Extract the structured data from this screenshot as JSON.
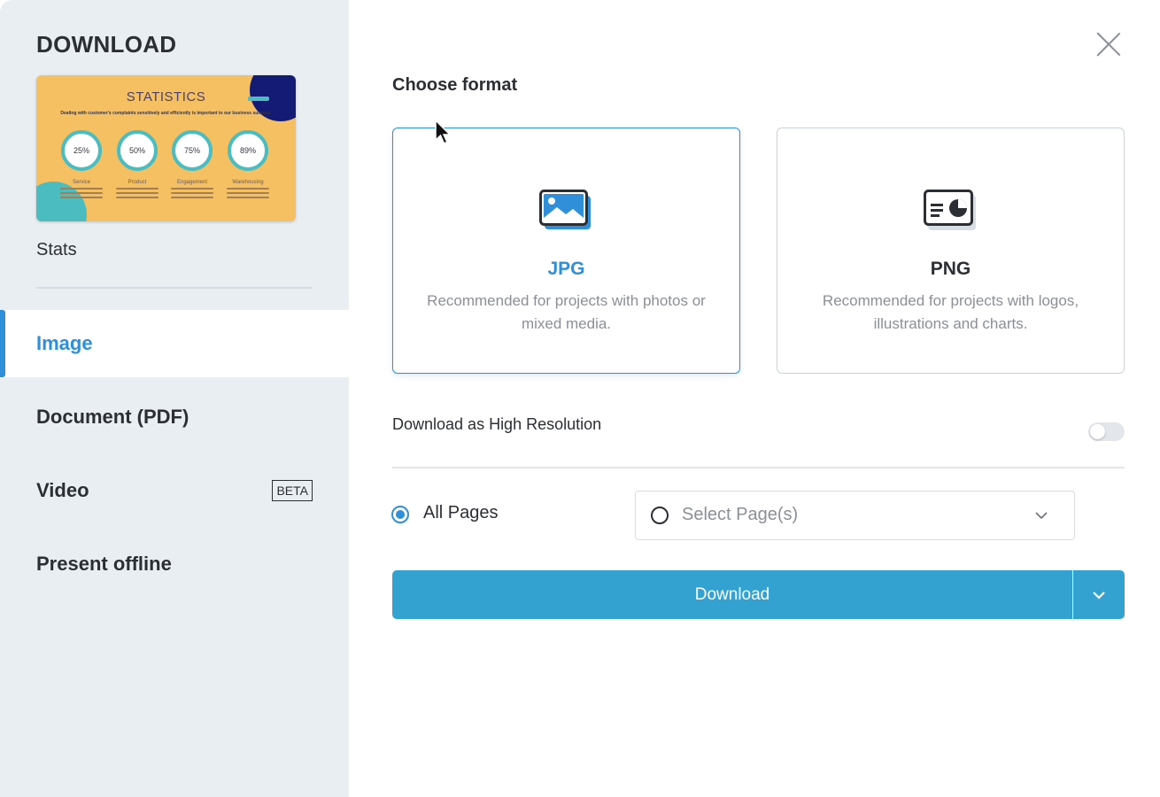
{
  "sidebar": {
    "title": "DOWNLOAD",
    "preview": {
      "title": "STATISTICS",
      "subtitle": "Dealing with customer's complaints sensitively and efficiently is important to our business success.",
      "stats": [
        {
          "value": "25%",
          "label": "Service"
        },
        {
          "value": "50%",
          "label": "Product"
        },
        {
          "value": "75%",
          "label": "Engagement"
        },
        {
          "value": "89%",
          "label": "Warehousing"
        }
      ]
    },
    "project_name": "Stats",
    "nav": [
      {
        "label": "Image",
        "active": true
      },
      {
        "label": "Document (PDF)",
        "active": false
      },
      {
        "label": "Video",
        "badge": "BETA",
        "active": false
      },
      {
        "label": "Present offline",
        "active": false
      }
    ]
  },
  "main": {
    "heading": "Choose format",
    "formats": [
      {
        "name": "JPG",
        "description": "Recommended for projects with photos or mixed media.",
        "icon": "image-icon",
        "selected": true
      },
      {
        "name": "PNG",
        "description": "Recommended for projects with logos, illustrations and charts.",
        "icon": "chart-card-icon",
        "selected": false
      }
    ],
    "high_res_label": "Download as High Resolution",
    "high_res_enabled": false,
    "pages": {
      "all_label": "All Pages",
      "select_placeholder": "Select Page(s)",
      "selected": "all"
    },
    "download_label": "Download"
  },
  "colors": {
    "accent": "#2f8fd8",
    "download_button": "#33a2d1",
    "sidebar_bg": "#e9eef3"
  }
}
